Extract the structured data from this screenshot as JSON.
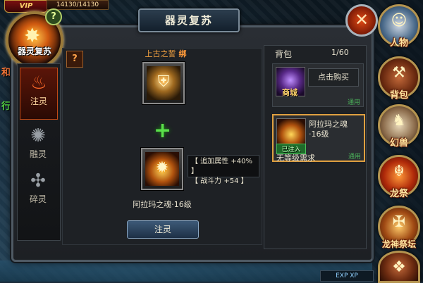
{
  "status": {
    "vip": "VIP",
    "hp": "14130/14130"
  },
  "emblem": {
    "label": "器灵复苏",
    "help": "?"
  },
  "panel": {
    "title": "器灵复苏",
    "close": "✕"
  },
  "tabs": [
    {
      "label": "注灵",
      "icon": "flame-icon",
      "glyph": "♨"
    },
    {
      "label": "融灵",
      "icon": "swirl-icon",
      "glyph": "✺"
    },
    {
      "label": "碎灵",
      "icon": "shards-icon",
      "glyph": "✣"
    }
  ],
  "center": {
    "item_name": "上古之誓",
    "bind_tag": "绑",
    "plus": "+",
    "attributes": [
      "【 追加属性 +40% 】",
      "【 战斗力 +54 】"
    ],
    "soul_name": "阿拉玛之魂·16级",
    "inject_button": "注灵",
    "small_icon": "?"
  },
  "bag": {
    "title": "背包",
    "count": "1/60",
    "shop": {
      "tag": "商城",
      "action": "点击购买",
      "bind_note": "通用"
    },
    "soul": {
      "tag": "已注入",
      "name": "阿拉玛之魂·16级",
      "requirement": "无等级需求",
      "bind_note": "通用"
    }
  },
  "right_menu": [
    {
      "label": "人物",
      "icon": "portrait-icon",
      "glyph": "☺"
    },
    {
      "label": "背包",
      "icon": "bag-icon",
      "glyph": "⚒"
    },
    {
      "label": "幻兽",
      "icon": "unicorn-icon",
      "glyph": "♞"
    },
    {
      "label": "龙祭",
      "icon": "dragon-icon",
      "glyph": "☬"
    },
    {
      "label": "龙神祭坛",
      "icon": "altar-icon",
      "glyph": "✠"
    }
  ],
  "exp": "EXP XP",
  "fragments": {
    "left_red": "和",
    "left_green": "行"
  },
  "colors": {
    "accent": "#e0a040",
    "button": "#3d5a78",
    "green_plus": "#5ae04a"
  }
}
